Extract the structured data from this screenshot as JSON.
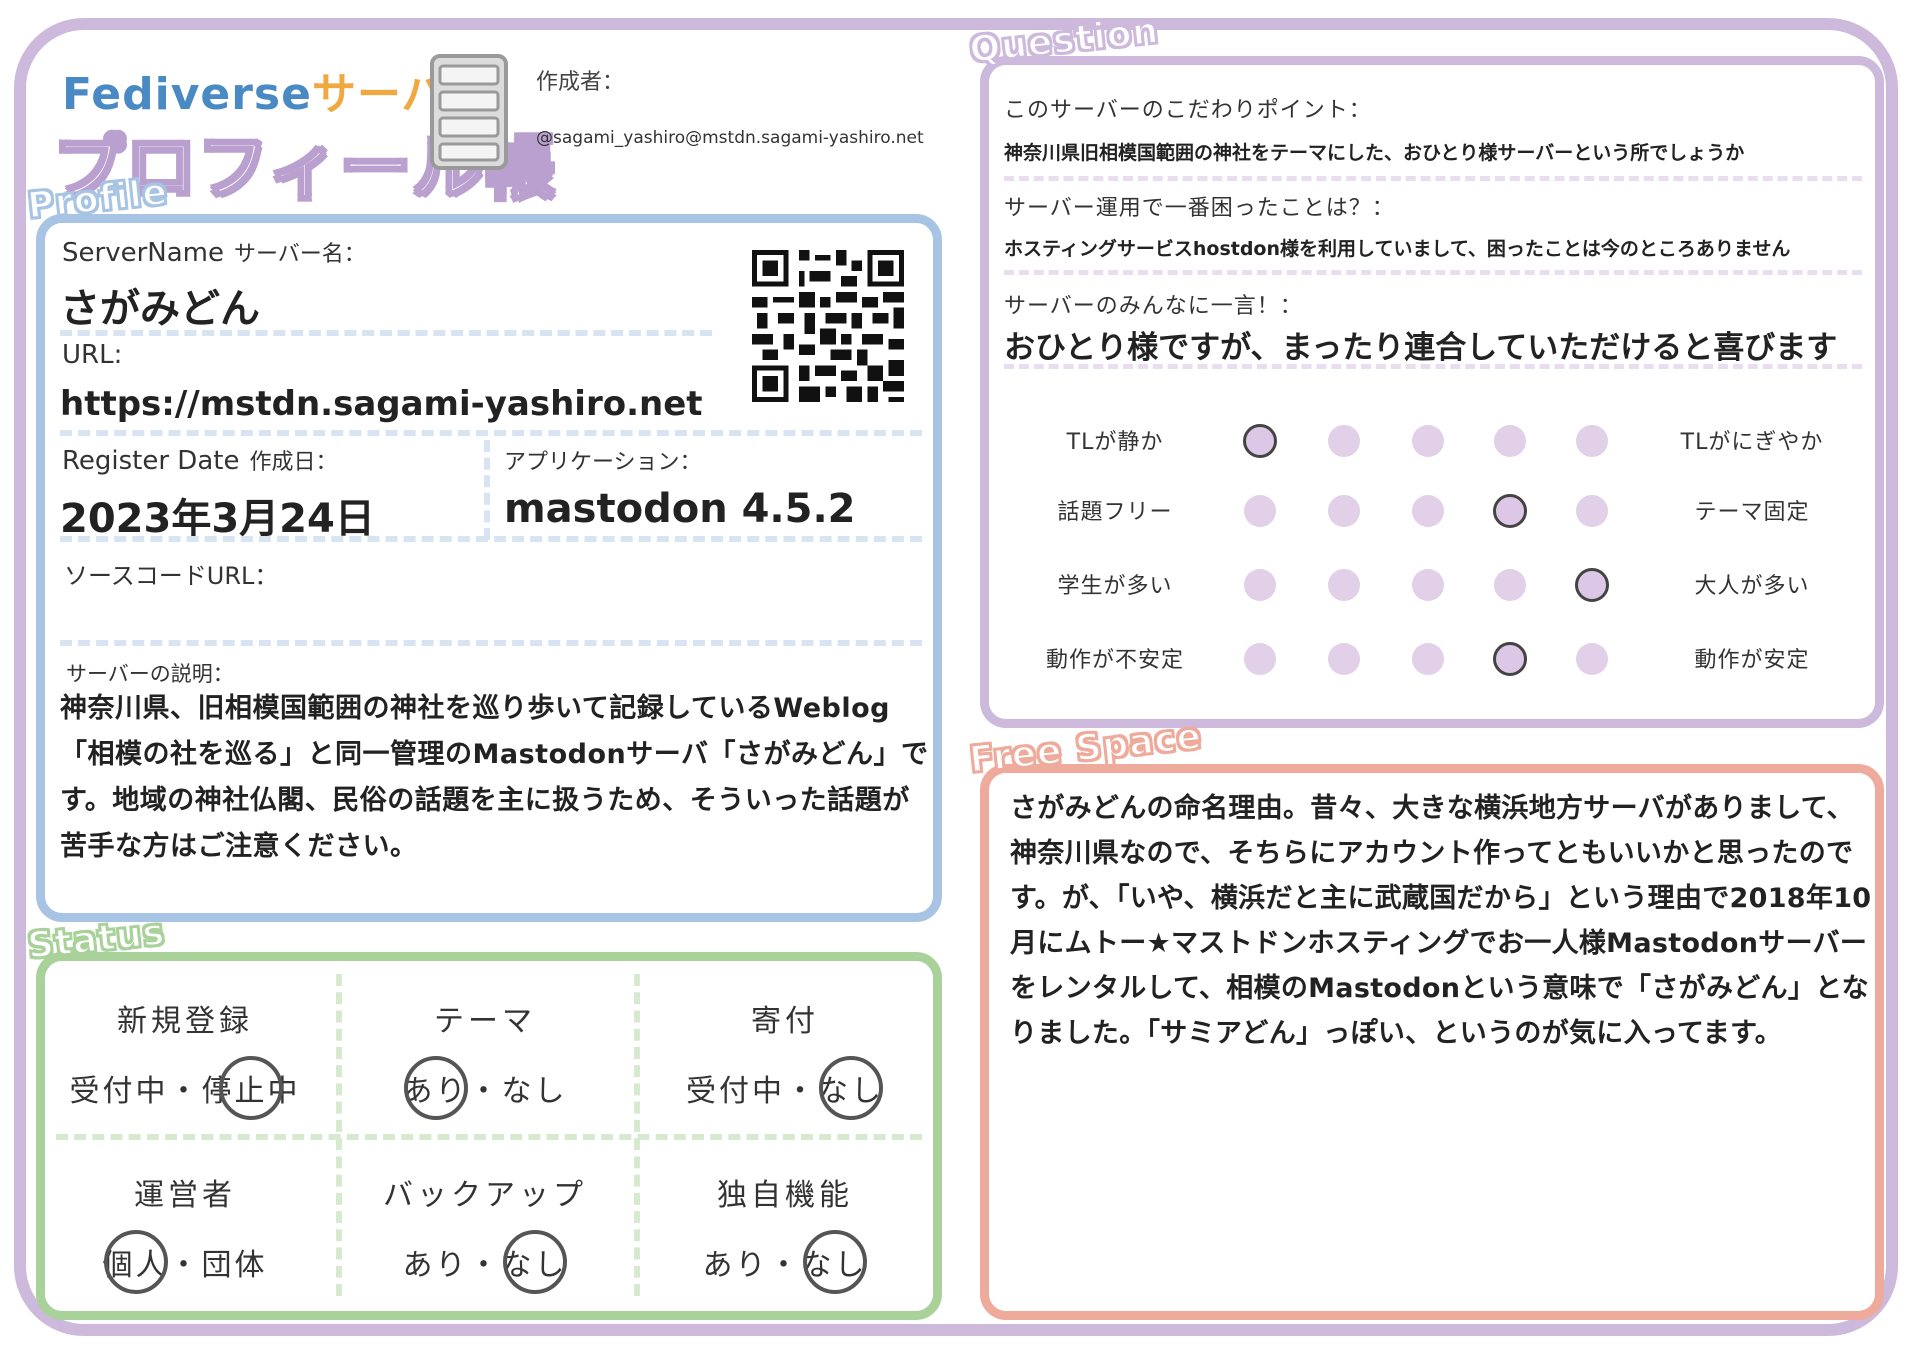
{
  "header": {
    "title_en": "Fediverse",
    "title_jp": "サーバー",
    "subtitle": "プロフィール帳",
    "author_label": "作成者：",
    "author_value": "@sagami_yashiro@mstdn.sagami-yashiro.net"
  },
  "sections": {
    "profile": "Profile",
    "status": "Status",
    "question": "Question",
    "free": "Free Space"
  },
  "profile": {
    "server_name_label_en": "ServerName",
    "server_name_label_jp": "サーバー名：",
    "server_name": "さがみどん",
    "url_label": "URL:",
    "url": "https://mstdn.sagami-yashiro.net",
    "register_label_en": "Register Date",
    "register_label_jp": "作成日：",
    "register_date": "2023年3月24日",
    "app_label": "アプリケーション：",
    "app_value": "mastodon 4.5.2",
    "source_label": "ソースコードURL：",
    "source_value": "",
    "desc_label": "サーバーの説明：",
    "description": "神奈川県、旧相模国範囲の神社を巡り歩いて記録しているWeblog「相模の社を巡る」と同一管理のMastodonサーバ「さがみどん」です。地域の神社仏閣、民俗の話題を主に扱うため、そういった話題が苦手な方はご注意ください。"
  },
  "status": {
    "cells": [
      {
        "head": "新規登録",
        "opt1": "受付中",
        "sep": "・",
        "opt2": "停止中",
        "selected": 2
      },
      {
        "head": "テーマ",
        "opt1": "あり",
        "sep": "・",
        "opt2": "なし",
        "selected": 1
      },
      {
        "head": "寄付",
        "opt1": "受付中",
        "sep": "・",
        "opt2": "なし",
        "selected": 2
      },
      {
        "head": "運営者",
        "opt1": "個人",
        "sep": "・",
        "opt2": "団体",
        "selected": 1
      },
      {
        "head": "バックアップ",
        "opt1": "あり",
        "sep": "・",
        "opt2": "なし",
        "selected": 2
      },
      {
        "head": "独自機能",
        "opt1": "あり",
        "sep": "・",
        "opt2": "なし",
        "selected": 2
      }
    ]
  },
  "question": {
    "q1_label": "このサーバーのこだわりポイント：",
    "q1_value": "神奈川県旧相模国範囲の神社をテーマにした、おひとり様サーバーという所でしょうか",
    "q2_label": "サーバー運用で一番困ったことは？：",
    "q2_value": "ホスティングサービスhostdon様を利用していまして、困ったことは今のところありません",
    "q3_label": "サーバーのみんなに一言！：",
    "q3_value": "おひとり様ですが、まったり連合していただけると喜びます",
    "scales": [
      {
        "left": "TLが静か",
        "right": "TLがにぎやか",
        "selected": 1
      },
      {
        "left": "話題フリー",
        "right": "テーマ固定",
        "selected": 4
      },
      {
        "left": "学生が多い",
        "right": "大人が多い",
        "selected": 5
      },
      {
        "left": "動作が不安定",
        "right": "動作が安定",
        "selected": 4
      }
    ]
  },
  "free_space": {
    "text": "さがみどんの命名理由。昔々、大きな横浜地方サーバがありまして、神奈川県なので、そちらにアカウント作ってともいいかと思ったのです。が、「いや、横浜だと主に武蔵国だから」という理由で2018年10月にムトー★マストドンホスティングでお一人様Mastodonサーバーをレンタルして、相模のMastodonという意味で「さがみどん」となりました。「サミアどん」っぽい、というのが気に入ってます。"
  },
  "colors": {
    "profile": "#a8c4e4",
    "status": "#a8d29a",
    "question": "#cdb9dc",
    "free": "#eeaa9a",
    "dot": "#e2cfe8"
  }
}
